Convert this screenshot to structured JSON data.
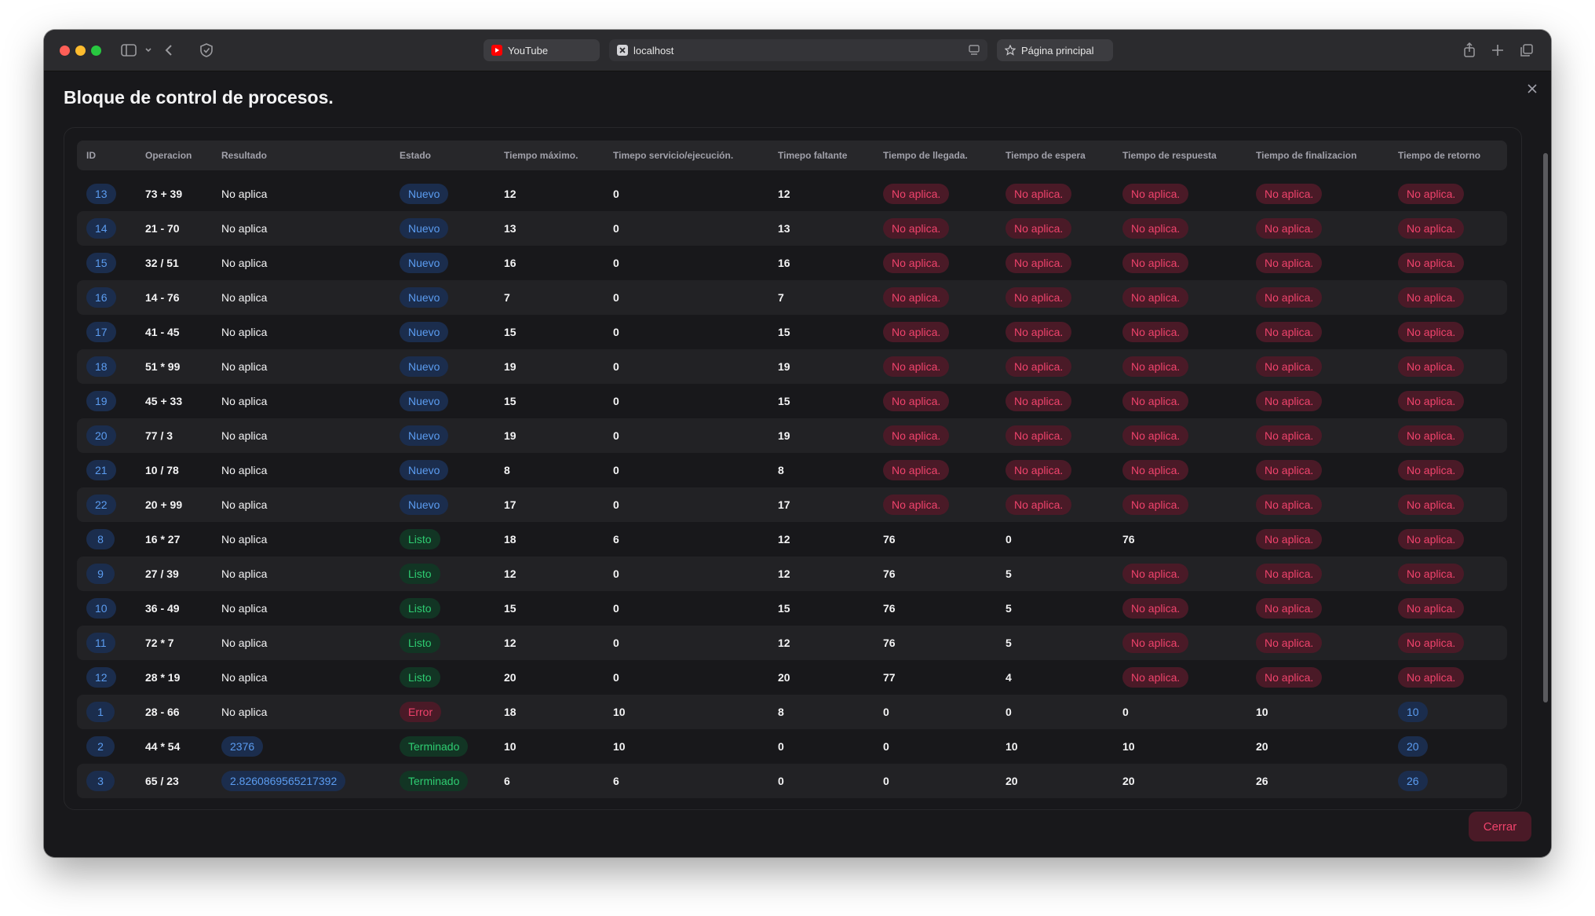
{
  "browser": {
    "tabs": [
      {
        "label": "YouTube"
      },
      {
        "label": "localhost"
      },
      {
        "label": "Página principal"
      }
    ]
  },
  "modal": {
    "title": "Bloque de control de procesos.",
    "close_label": "Cerrar"
  },
  "table": {
    "headers": [
      "ID",
      "Operacion",
      "Resultado",
      "Estado",
      "Tiempo máximo.",
      "Timepo servicio/ejecución.",
      "Timepo faltante",
      "Tiempo de llegada.",
      "Tiempo de espera",
      "Tiempo de respuesta",
      "Tiempo de finalizacion",
      "Tiempo de retorno"
    ],
    "rows": [
      {
        "id": "13",
        "op": "73 + 39",
        "res": "No aplica",
        "estado": "Nuevo",
        "tmax": "12",
        "tserv": "0",
        "tfalt": "12",
        "tlleg": "No aplica.",
        "tesp": "No aplica.",
        "tresp": "No aplica.",
        "tfin": "No aplica.",
        "tret": "No aplica."
      },
      {
        "id": "14",
        "op": "21 - 70",
        "res": "No aplica",
        "estado": "Nuevo",
        "tmax": "13",
        "tserv": "0",
        "tfalt": "13",
        "tlleg": "No aplica.",
        "tesp": "No aplica.",
        "tresp": "No aplica.",
        "tfin": "No aplica.",
        "tret": "No aplica."
      },
      {
        "id": "15",
        "op": "32 / 51",
        "res": "No aplica",
        "estado": "Nuevo",
        "tmax": "16",
        "tserv": "0",
        "tfalt": "16",
        "tlleg": "No aplica.",
        "tesp": "No aplica.",
        "tresp": "No aplica.",
        "tfin": "No aplica.",
        "tret": "No aplica."
      },
      {
        "id": "16",
        "op": "14 - 76",
        "res": "No aplica",
        "estado": "Nuevo",
        "tmax": "7",
        "tserv": "0",
        "tfalt": "7",
        "tlleg": "No aplica.",
        "tesp": "No aplica.",
        "tresp": "No aplica.",
        "tfin": "No aplica.",
        "tret": "No aplica."
      },
      {
        "id": "17",
        "op": "41 - 45",
        "res": "No aplica",
        "estado": "Nuevo",
        "tmax": "15",
        "tserv": "0",
        "tfalt": "15",
        "tlleg": "No aplica.",
        "tesp": "No aplica.",
        "tresp": "No aplica.",
        "tfin": "No aplica.",
        "tret": "No aplica."
      },
      {
        "id": "18",
        "op": "51 * 99",
        "res": "No aplica",
        "estado": "Nuevo",
        "tmax": "19",
        "tserv": "0",
        "tfalt": "19",
        "tlleg": "No aplica.",
        "tesp": "No aplica.",
        "tresp": "No aplica.",
        "tfin": "No aplica.",
        "tret": "No aplica."
      },
      {
        "id": "19",
        "op": "45 + 33",
        "res": "No aplica",
        "estado": "Nuevo",
        "tmax": "15",
        "tserv": "0",
        "tfalt": "15",
        "tlleg": "No aplica.",
        "tesp": "No aplica.",
        "tresp": "No aplica.",
        "tfin": "No aplica.",
        "tret": "No aplica."
      },
      {
        "id": "20",
        "op": "77 / 3",
        "res": "No aplica",
        "estado": "Nuevo",
        "tmax": "19",
        "tserv": "0",
        "tfalt": "19",
        "tlleg": "No aplica.",
        "tesp": "No aplica.",
        "tresp": "No aplica.",
        "tfin": "No aplica.",
        "tret": "No aplica."
      },
      {
        "id": "21",
        "op": "10 / 78",
        "res": "No aplica",
        "estado": "Nuevo",
        "tmax": "8",
        "tserv": "0",
        "tfalt": "8",
        "tlleg": "No aplica.",
        "tesp": "No aplica.",
        "tresp": "No aplica.",
        "tfin": "No aplica.",
        "tret": "No aplica."
      },
      {
        "id": "22",
        "op": "20 + 99",
        "res": "No aplica",
        "estado": "Nuevo",
        "tmax": "17",
        "tserv": "0",
        "tfalt": "17",
        "tlleg": "No aplica.",
        "tesp": "No aplica.",
        "tresp": "No aplica.",
        "tfin": "No aplica.",
        "tret": "No aplica."
      },
      {
        "id": "8",
        "op": "16 * 27",
        "res": "No aplica",
        "estado": "Listo",
        "tmax": "18",
        "tserv": "6",
        "tfalt": "12",
        "tlleg": "76",
        "tesp": "0",
        "tresp": "76",
        "tfin": "No aplica.",
        "tret": "No aplica."
      },
      {
        "id": "9",
        "op": "27 / 39",
        "res": "No aplica",
        "estado": "Listo",
        "tmax": "12",
        "tserv": "0",
        "tfalt": "12",
        "tlleg": "76",
        "tesp": "5",
        "tresp": "No aplica.",
        "tfin": "No aplica.",
        "tret": "No aplica."
      },
      {
        "id": "10",
        "op": "36 - 49",
        "res": "No aplica",
        "estado": "Listo",
        "tmax": "15",
        "tserv": "0",
        "tfalt": "15",
        "tlleg": "76",
        "tesp": "5",
        "tresp": "No aplica.",
        "tfin": "No aplica.",
        "tret": "No aplica."
      },
      {
        "id": "11",
        "op": "72 * 7",
        "res": "No aplica",
        "estado": "Listo",
        "tmax": "12",
        "tserv": "0",
        "tfalt": "12",
        "tlleg": "76",
        "tesp": "5",
        "tresp": "No aplica.",
        "tfin": "No aplica.",
        "tret": "No aplica."
      },
      {
        "id": "12",
        "op": "28 * 19",
        "res": "No aplica",
        "estado": "Listo",
        "tmax": "20",
        "tserv": "0",
        "tfalt": "20",
        "tlleg": "77",
        "tesp": "4",
        "tresp": "No aplica.",
        "tfin": "No aplica.",
        "tret": "No aplica."
      },
      {
        "id": "1",
        "op": "28 - 66",
        "res": "No aplica",
        "estado": "Error",
        "tmax": "18",
        "tserv": "10",
        "tfalt": "8",
        "tlleg": "0",
        "tesp": "0",
        "tresp": "0",
        "tfin": "10",
        "tret": "10"
      },
      {
        "id": "2",
        "op": "44 * 54",
        "res": "2376",
        "estado": "Terminado",
        "tmax": "10",
        "tserv": "10",
        "tfalt": "0",
        "tlleg": "0",
        "tesp": "10",
        "tresp": "10",
        "tfin": "20",
        "tret": "20"
      },
      {
        "id": "3",
        "op": "65 / 23",
        "res": "2.8260869565217392",
        "estado": "Terminado",
        "tmax": "6",
        "tserv": "6",
        "tfalt": "0",
        "tlleg": "0",
        "tesp": "20",
        "tresp": "20",
        "tfin": "26",
        "tret": "26"
      }
    ]
  },
  "colors": {
    "nuevo": "#5b9cf0",
    "listo": "#2ecc71",
    "error": "#f0436c",
    "no_aplica": "#f0436c"
  }
}
